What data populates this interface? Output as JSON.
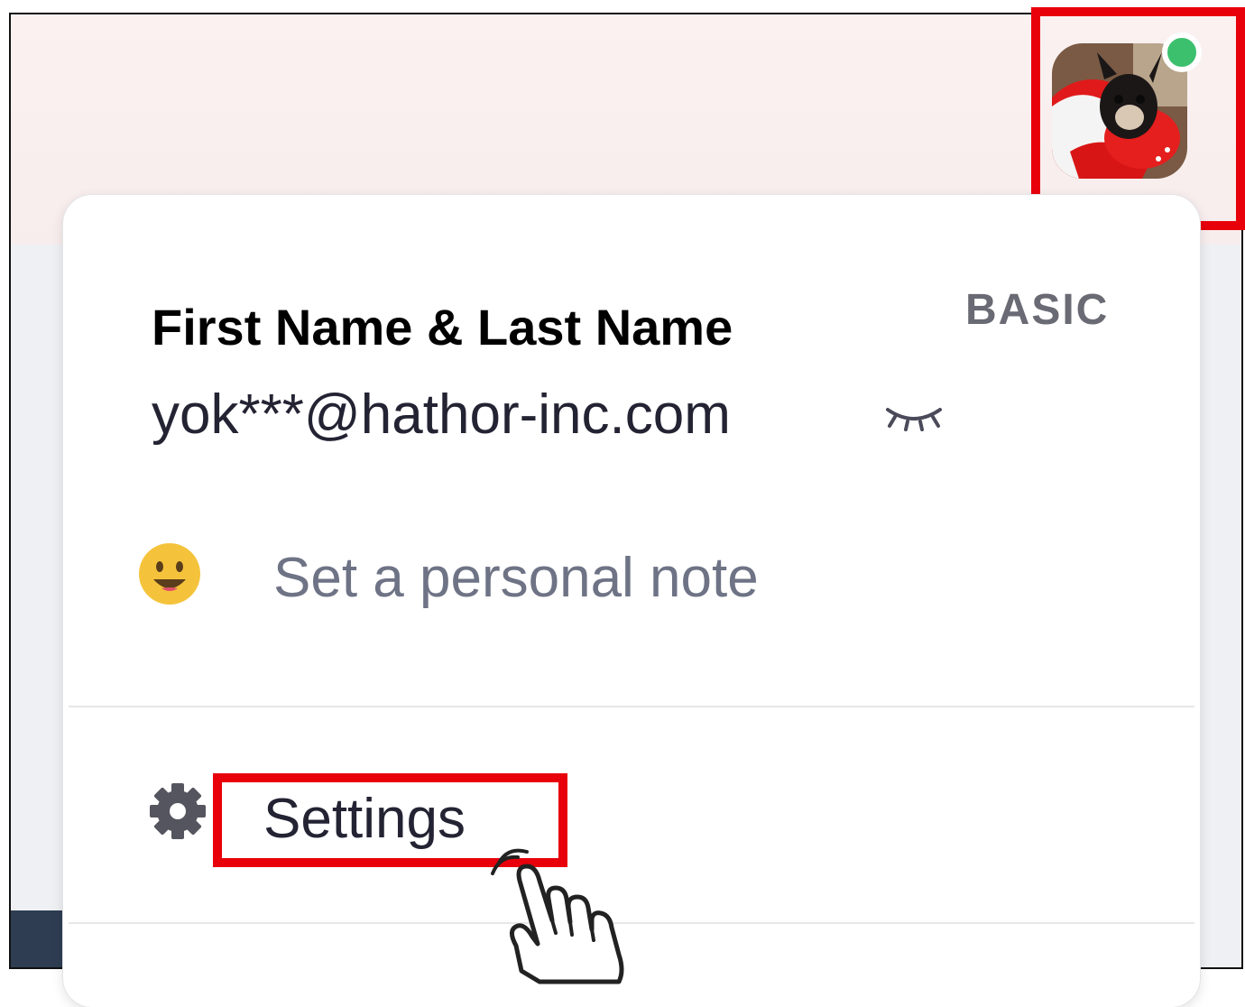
{
  "profile": {
    "name": "First Name & Last Name",
    "plan": "BASIC",
    "email": "yok***@hathor-inc.com",
    "status_color": "#3cc06e"
  },
  "personal_note": {
    "placeholder": "Set a personal note",
    "emoji_icon": "smiley-face-icon"
  },
  "menu": {
    "settings_label": "Settings",
    "settings_icon": "gear-icon"
  },
  "annotations": {
    "highlight_color": "#e8000b",
    "pointer_icon": "hand-pointer-icon"
  }
}
